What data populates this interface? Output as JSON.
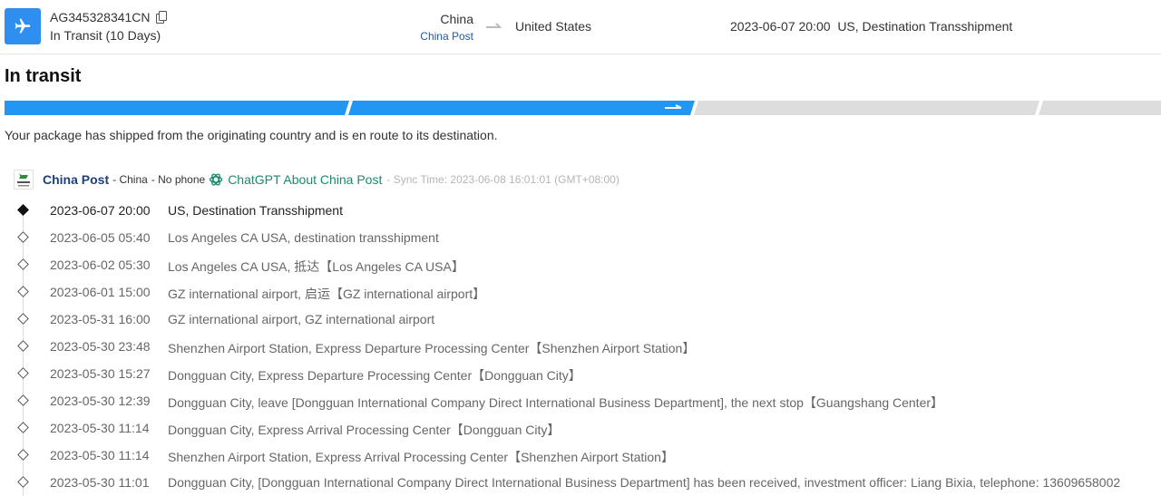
{
  "header": {
    "tracking_number": "AG345328341CN",
    "transit_status": "In Transit (10 Days)",
    "origin_country": "China",
    "origin_carrier": "China Post",
    "destination_country": "United States",
    "latest_event": "2023-06-07 20:00  US, Destination Transshipment",
    "icons": {
      "plane": "airplane-icon",
      "copy": "copy-icon",
      "arrow": "arrow-right-icon"
    },
    "accent_color": "#2f8ff0"
  },
  "status": {
    "title": "In transit",
    "description": "Your package has shipped from the originating country and is en route to its destination.",
    "progress": {
      "total_stages": 4,
      "completed_stages": 2,
      "active_color": "#2196f3",
      "inactive_color": "#dddddd"
    }
  },
  "carrier": {
    "name": "China Post",
    "country": "- China",
    "phone": "- No phone",
    "gpt_link": "ChatGPT About China Post",
    "sync_time": "- Sync Time: 2023-06-08 16:01:01 (GMT+08:00)",
    "icons": {
      "logo": "china-post-logo",
      "gpt": "chatgpt-icon"
    }
  },
  "events": [
    {
      "time": "2023-06-07 20:00",
      "description": "US, Destination Transshipment"
    },
    {
      "time": "2023-06-05 05:40",
      "description": "Los Angeles CA USA, destination transshipment"
    },
    {
      "time": "2023-06-02 05:30",
      "description": "Los Angeles CA USA, 抵达【Los Angeles CA USA】"
    },
    {
      "time": "2023-06-01 15:00",
      "description": "GZ international airport, 启运【GZ international airport】"
    },
    {
      "time": "2023-05-31 16:00",
      "description": "GZ international airport, GZ international airport"
    },
    {
      "time": "2023-05-30 23:48",
      "description": "Shenzhen Airport Station, Express Departure Processing Center【Shenzhen Airport Station】"
    },
    {
      "time": "2023-05-30 15:27",
      "description": "Dongguan City, Express Departure Processing Center【Dongguan City】"
    },
    {
      "time": "2023-05-30 12:39",
      "description": "Dongguan City, leave [Dongguan International Company Direct International Business Department], the next stop【Guangshang Center】"
    },
    {
      "time": "2023-05-30 11:14",
      "description": "Dongguan City, Express Arrival Processing Center【Dongguan City】"
    },
    {
      "time": "2023-05-30 11:14",
      "description": "Shenzhen Airport Station, Express Arrival Processing Center【Shenzhen Airport Station】"
    },
    {
      "time": "2023-05-30 11:01",
      "description": "Dongguan City, [Dongguan International Company Direct International Business Department] has been received, investment officer: Liang Bixia, telephone: 13609658002"
    }
  ]
}
